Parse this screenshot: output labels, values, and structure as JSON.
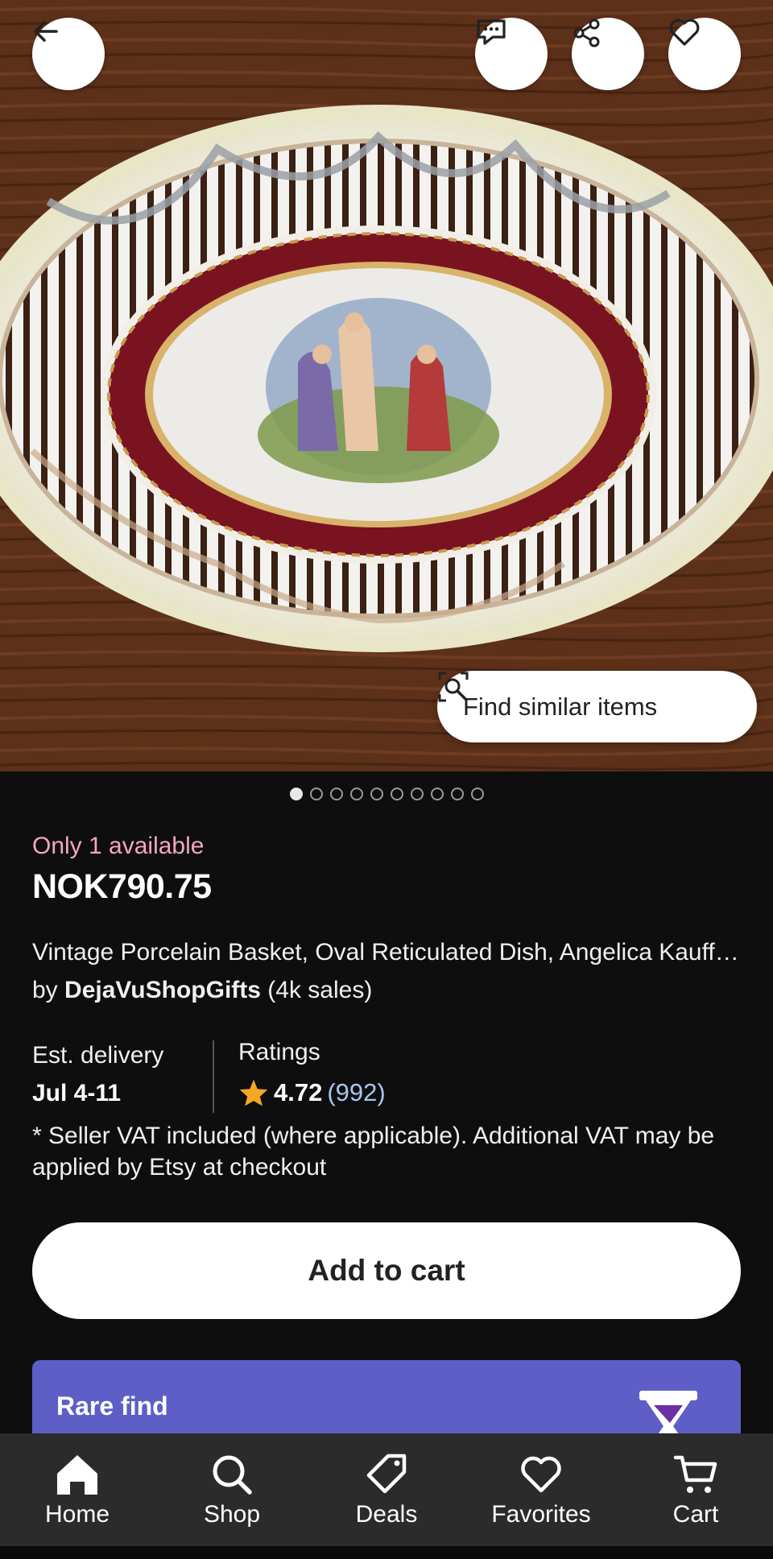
{
  "hero": {
    "find_similar_label": "Find similar items",
    "image_count": 10,
    "active_image_index": 0
  },
  "icons": {
    "back": "arrow-left-icon",
    "message": "message-icon",
    "share": "share-icon",
    "favorite": "heart-icon",
    "find_similar": "visual-search-icon",
    "rating_star": "star-icon",
    "rare_find": "hourglass-icon"
  },
  "listing": {
    "availability": "Only 1 available",
    "price": "NOK790.75",
    "title": "Vintage Porcelain Basket, Oval Reticulated Dish, Angelica Kauffman Style Scene",
    "by_prefix": "by ",
    "shop_name": "DejaVuShopGifts",
    "sales": " (4k sales)"
  },
  "delivery": {
    "label": "Est. delivery",
    "value": "Jul 4-11"
  },
  "ratings": {
    "label": "Ratings",
    "score": "4.72",
    "count": "(992)"
  },
  "vat_note": "* Seller VAT included (where applicable). Additional VAT may be applied by Etsy at checkout",
  "add_to_cart_label": "Add to cart",
  "rare_find": {
    "title": "Rare find"
  },
  "nav": {
    "items": [
      {
        "label": "Home",
        "icon": "home-icon"
      },
      {
        "label": "Shop",
        "icon": "search-icon"
      },
      {
        "label": "Deals",
        "icon": "tag-icon"
      },
      {
        "label": "Favorites",
        "icon": "heart-icon"
      },
      {
        "label": "Cart",
        "icon": "cart-icon"
      }
    ]
  },
  "colors": {
    "availability": "#f4a6c0",
    "rating_count": "#a9c6ec",
    "rare_find_bg": "#5d5fc7",
    "star": "#f5a623",
    "background": "#0e0e0e",
    "nav_bg": "#2b2b2b"
  }
}
